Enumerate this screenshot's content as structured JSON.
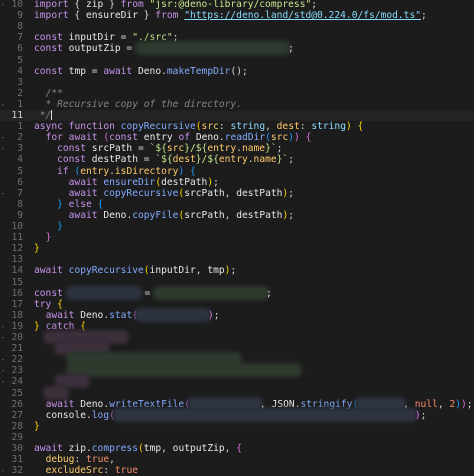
{
  "editor": {
    "gutter": [
      "-",
      "",
      "",
      "",
      "",
      "",
      "",
      "",
      "",
      "-",
      "",
      "",
      "-",
      "-",
      "",
      "",
      "",
      "-",
      "",
      "",
      "",
      "",
      "",
      "",
      "",
      "",
      "",
      "",
      "",
      "-",
      "-",
      "",
      "-",
      "-",
      "-",
      "",
      "",
      "",
      "",
      "",
      "",
      "",
      "-",
      ""
    ],
    "line_numbers": [
      "10",
      "9",
      "8",
      "7",
      "6",
      "5",
      "4",
      "3",
      "2",
      "1",
      "11",
      "1",
      "2",
      "3",
      "4",
      "5",
      "6",
      "7",
      "8",
      "9",
      "10",
      "11",
      "12",
      "13",
      "14",
      "15",
      "16",
      "17",
      "18",
      "19",
      "20",
      "21",
      "22",
      "23",
      "24",
      "25",
      "26",
      "27",
      "28",
      "29",
      "30",
      "31",
      "32"
    ],
    "current_line_index": 10,
    "t": {
      "import": "import",
      "zip": "zip",
      "from": "from",
      "jsr_compress": "\"jsr:@deno-library/compress\"",
      "ensureDir": "ensureDir",
      "std_url": "\"https://deno.land/std@0.224.0/fs/mod.ts\"",
      "const": "const",
      "inputDir": "inputDir",
      "src_str": "\"./src\"",
      "outputZip": "outputZip",
      "tmp": "tmp",
      "await": "await",
      "Deno": "Deno",
      "makeTempDir": "makeTempDir",
      "doc_open": "/**",
      "doc_text": " * Recursive copy of the directory.",
      "doc_close": " */",
      "async": "async",
      "function": "function",
      "copyRecursive": "copyRecursive",
      "src": "src",
      "string": "string",
      "dest": "dest",
      "for": "for",
      "entry": "entry",
      "of": "of",
      "readDir": "readDir",
      "srcPath": "srcPath",
      "destPath": "destPath",
      "name": "name",
      "if": "if",
      "isDirectory": "isDirectory",
      "else": "else",
      "copyFile": "copyFile",
      "try": "try",
      "stat": "stat",
      "catch": "catch",
      "writeTextFile": "writeTextFile",
      "JSON": "JSON",
      "stringify": "stringify",
      "null": "null",
      "two": "2",
      "console": "console",
      "log": "log",
      "compress": "compress",
      "debug": "debug",
      "true": "true",
      "excludeSrc": "excludeSrc"
    }
  }
}
